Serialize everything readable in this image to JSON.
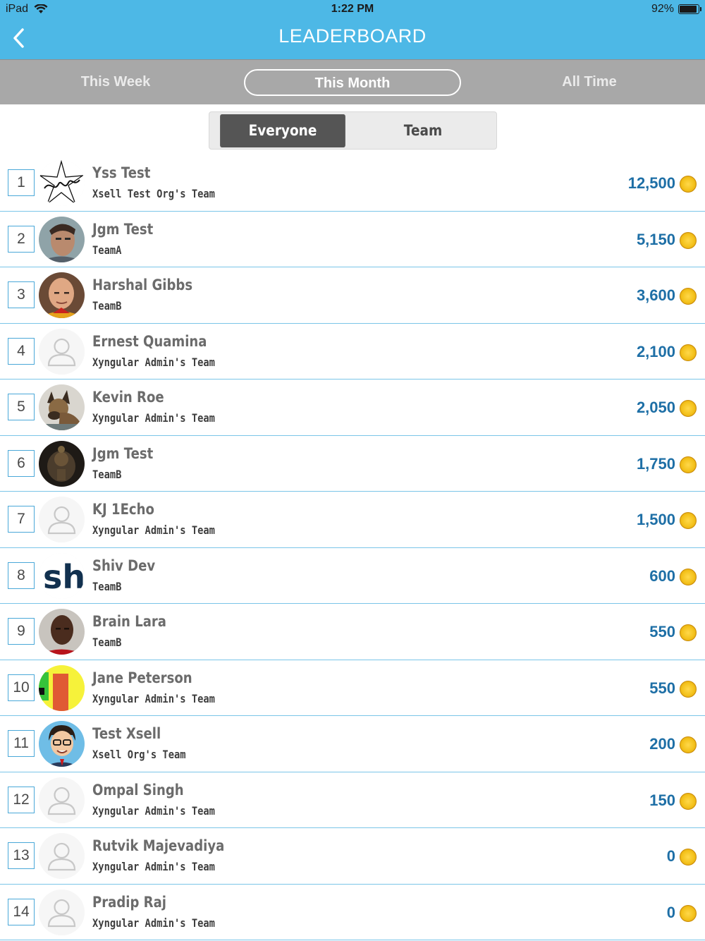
{
  "status": {
    "carrier": "iPad",
    "time": "1:22 PM",
    "battery": "92%",
    "battery_level": 0.92
  },
  "header": {
    "title": "LEADERBOARD"
  },
  "period_tabs": [
    {
      "label": "This Week",
      "active": false
    },
    {
      "label": "This Month",
      "active": true
    },
    {
      "label": "All Time",
      "active": false
    }
  ],
  "segment": {
    "options": [
      "Everyone",
      "Team"
    ],
    "selected": "Everyone"
  },
  "colors": {
    "accent": "#4db8e6",
    "points": "#1e6fa6",
    "divider": "#7ac5e8",
    "tab_bar": "#a8a8a8"
  },
  "rows": [
    {
      "rank": "1",
      "name": "Yss Test",
      "team": "Xsell Test Org's Team",
      "points": "12,500",
      "avatar": "ysd-signature-logo"
    },
    {
      "rank": "2",
      "name": "Jgm Test",
      "team": "TeamA",
      "points": "5,150",
      "avatar": "photo-man"
    },
    {
      "rank": "3",
      "name": "Harshal Gibbs",
      "team": "TeamB",
      "points": "3,600",
      "avatar": "photo-bald-man"
    },
    {
      "rank": "4",
      "name": "Ernest Quamina",
      "team": "Xyngular Admin's Team",
      "points": "2,100",
      "avatar": "default-user-icon"
    },
    {
      "rank": "5",
      "name": "Kevin Roe",
      "team": "Xyngular Admin's Team",
      "points": "2,050",
      "avatar": "photo-dog"
    },
    {
      "rank": "6",
      "name": "Jgm Test",
      "team": "TeamB",
      "points": "1,750",
      "avatar": "photo-idol"
    },
    {
      "rank": "7",
      "name": "KJ 1Echo",
      "team": "Xyngular Admin's Team",
      "points": "1,500",
      "avatar": "default-user-icon"
    },
    {
      "rank": "8",
      "name": "Shiv Dev",
      "team": "TeamB",
      "points": "600",
      "avatar": "sh-logo"
    },
    {
      "rank": "9",
      "name": "Brain Lara",
      "team": "TeamB",
      "points": "550",
      "avatar": "photo-cricketer"
    },
    {
      "rank": "10",
      "name": "Jane Peterson",
      "team": "Xyngular Admin's Team",
      "points": "550",
      "avatar": "colorful-abstract"
    },
    {
      "rank": "11",
      "name": "Test Xsell",
      "team": "Xsell Org's Team",
      "points": "200",
      "avatar": "cartoon-man"
    },
    {
      "rank": "12",
      "name": "Ompal Singh",
      "team": "Xyngular Admin's Team",
      "points": "150",
      "avatar": "default-user-icon"
    },
    {
      "rank": "13",
      "name": "Rutvik Majevadiya",
      "team": "Xyngular Admin's Team",
      "points": "0",
      "avatar": "default-user-icon"
    },
    {
      "rank": "14",
      "name": "Pradip Raj",
      "team": "Xyngular Admin's Team",
      "points": "0",
      "avatar": "default-user-icon"
    }
  ]
}
